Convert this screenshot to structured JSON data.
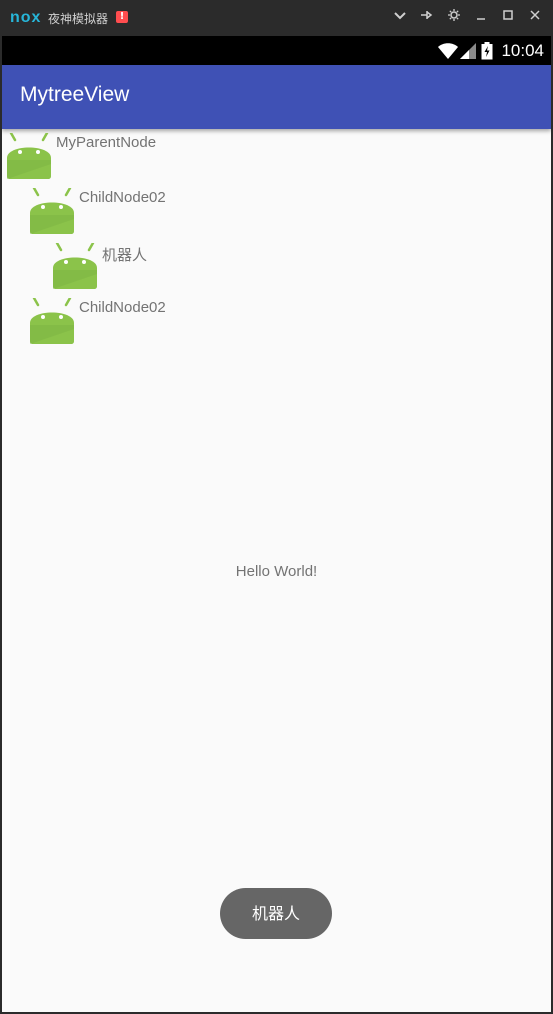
{
  "emulator": {
    "logo_text": "nox",
    "name": "夜神模拟器",
    "alert_icon": "!",
    "controls": [
      "chevron-down-icon",
      "pin-icon",
      "settings-icon",
      "minimize-icon",
      "maximize-icon",
      "close-icon"
    ]
  },
  "status_bar": {
    "time": "10:04",
    "icons": [
      "wifi-icon",
      "signal-icon",
      "battery-icon"
    ]
  },
  "app_bar": {
    "title": "MytreeView"
  },
  "tree": {
    "nodes": [
      {
        "label": "MyParentNode",
        "icon": "android-icon",
        "level": 0
      },
      {
        "label": "ChildNode02",
        "icon": "android-icon",
        "level": 1
      },
      {
        "label": "机器人",
        "icon": "android-icon",
        "level": 2
      },
      {
        "label": "ChildNode02",
        "icon": "android-icon",
        "level": 1
      }
    ]
  },
  "main": {
    "hello_text": "Hello World!"
  },
  "toast": {
    "message": "机器人"
  },
  "colors": {
    "app_bar": "#3f51b5",
    "android_green": "#8bc34a",
    "background": "#fafafa",
    "toast": "#666666"
  }
}
